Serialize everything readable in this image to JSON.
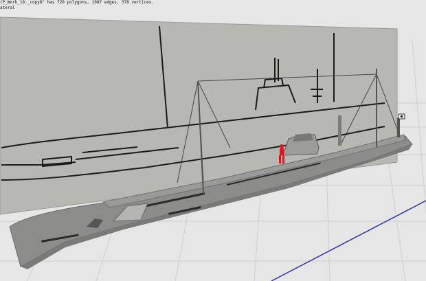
{
  "viewport": {
    "status_line_1": "(P_Work_16:_copy8\" has 720 polygons, 1087 edges, 378 vertices.",
    "status_line_2": "ateral",
    "colors": {
      "background": "#e6e6e6",
      "grid": "#cfcfcf",
      "reference_plane": "#b8b8b3",
      "hull": "#8c8c8a",
      "deck": "#9a9a98",
      "figure": "#e0141a",
      "axis": "#2f35a8"
    },
    "scene_objects": [
      "reference-image-plane",
      "submarine-model",
      "crew-figure",
      "flag",
      "ground-grid",
      "axis-line"
    ]
  }
}
